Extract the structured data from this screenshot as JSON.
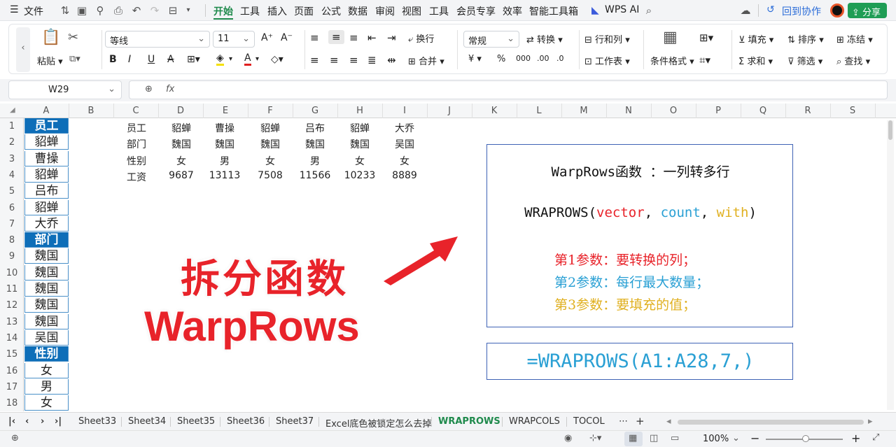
{
  "menubar": {
    "file_label": "文件",
    "tabs": [
      "开始",
      "工具",
      "插入",
      "页面",
      "公式",
      "数据",
      "审阅",
      "视图",
      "工具",
      "会员专享",
      "效率",
      "智能工具箱"
    ],
    "wps_ai": "WPS AI",
    "collab": "回到协作",
    "share": "分享"
  },
  "ribbon": {
    "paste": "粘贴",
    "font_name": "等线",
    "font_size": "11",
    "wrap": "换行",
    "merge": "合并",
    "number_format": "常规",
    "convert": "转换",
    "rows_cols": "行和列",
    "worksheet": "工作表",
    "cond_format": "条件格式",
    "fill": "填充",
    "sort": "排序",
    "freeze": "冻结",
    "sum": "求和",
    "filter": "筛选",
    "find": "查找"
  },
  "namebox": "W29",
  "columns": [
    "A",
    "B",
    "C",
    "D",
    "E",
    "F",
    "G",
    "H",
    "I",
    "J",
    "K",
    "L",
    "M",
    "N",
    "O",
    "P",
    "Q",
    "R",
    "S"
  ],
  "rows": [
    "1",
    "2",
    "3",
    "4",
    "5",
    "6",
    "7",
    "8",
    "9",
    "10",
    "11",
    "12",
    "13",
    "14",
    "15",
    "16",
    "17",
    "18"
  ],
  "col_a": [
    "员工",
    "貂蝉",
    "曹操",
    "貂蝉",
    "吕布",
    "貂蝉",
    "大乔",
    "部门",
    "魏国",
    "魏国",
    "魏国",
    "魏国",
    "魏国",
    "吴国",
    "性别",
    "女",
    "男",
    "女"
  ],
  "table": [
    [
      "员工",
      "貂蝉",
      "曹操",
      "貂蝉",
      "吕布",
      "貂蝉",
      "大乔"
    ],
    [
      "部门",
      "魏国",
      "魏国",
      "魏国",
      "魏国",
      "魏国",
      "吴国"
    ],
    [
      "性别",
      "女",
      "男",
      "女",
      "男",
      "女",
      "女"
    ],
    [
      "工资",
      "9687",
      "13113",
      "7508",
      "11566",
      "10233",
      "8889"
    ]
  ],
  "overlay": {
    "title_cn": "拆分函数",
    "title_en": "WarpRows"
  },
  "panel": {
    "heading": "WarpRows函数 ：一列转多行",
    "syntax_fn": "WRAPROWS(",
    "syntax_p1": "vector",
    "syntax_sep1": ", ",
    "syntax_p2": "count",
    "syntax_sep2": ", ",
    "syntax_p3": "with",
    "syntax_close": ")",
    "param1": "第1参数：要转换的列；",
    "param2": "第2参数：每行最大数量；",
    "param3": "第3参数：要填充的值；",
    "formula": "=WRAPROWS(A1:A28,7,)"
  },
  "colors": {
    "accent": "#1f8a4c",
    "header_fill": "#0e6eb8",
    "red": "#e8232a",
    "blue": "#2aa0d4",
    "gold": "#e0b020"
  },
  "sheets": [
    "Sheet33",
    "Sheet34",
    "Sheet35",
    "Sheet36",
    "Sheet37",
    "Excel底色被锁定怎么去掉",
    "WRAPROWS",
    "WRAPCOLS",
    "TOCOL"
  ],
  "active_sheet": "WRAPROWS",
  "status": {
    "zoom": "100%"
  }
}
